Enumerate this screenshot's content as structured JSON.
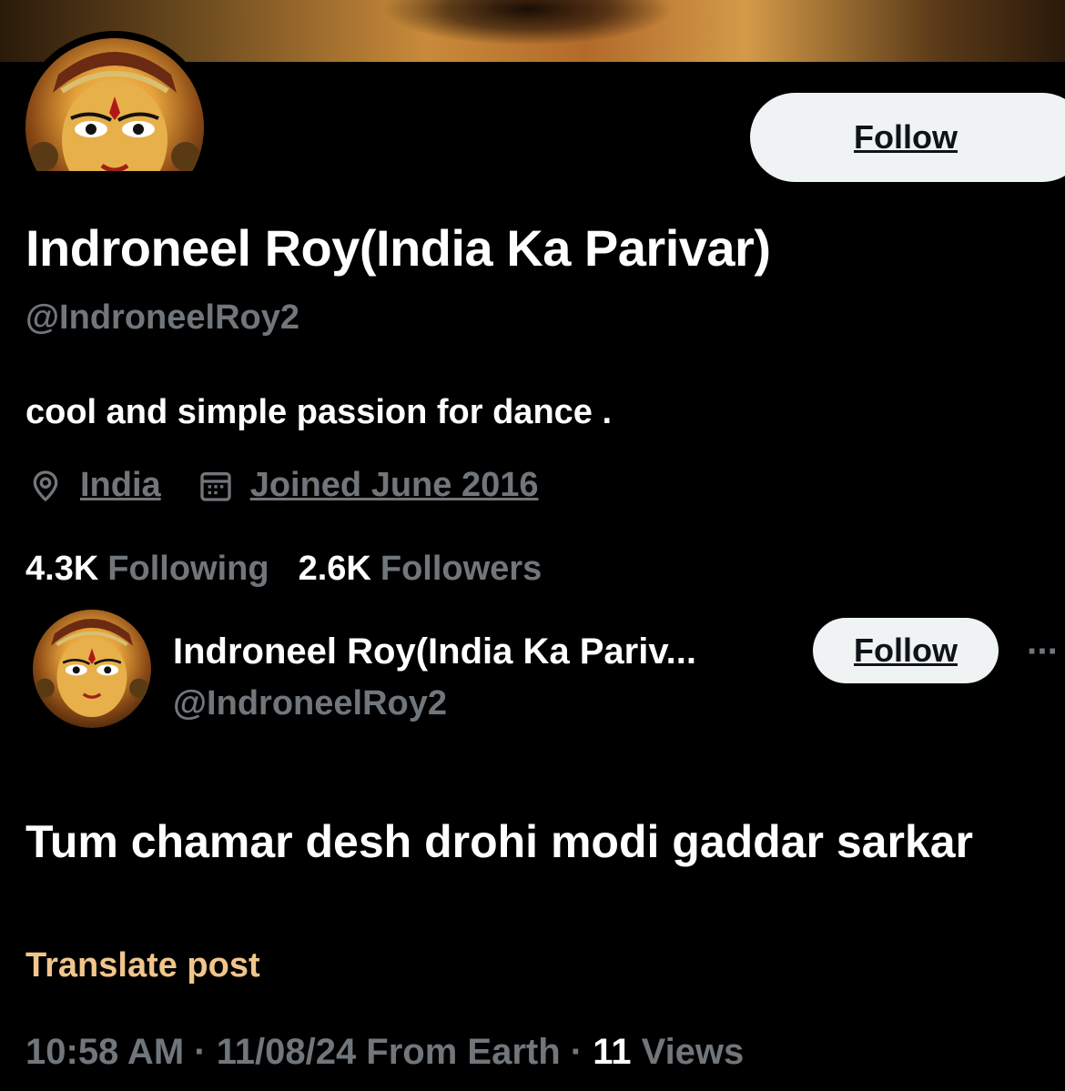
{
  "profile": {
    "display_name": "Indroneel Roy(India Ka Parivar)",
    "handle": "@IndroneelRoy2",
    "bio": "cool and simple passion for dance .",
    "location": "India",
    "joined": "Joined June 2016",
    "following_count": "4.3K",
    "following_label": "Following",
    "followers_count": "2.6K",
    "followers_label": "Followers",
    "follow_label": "Follow"
  },
  "post": {
    "author_name": "Indroneel Roy(India Ka Pariv...",
    "author_handle": "@IndroneelRoy2",
    "follow_label": "Follow",
    "more_label": "···",
    "text": "Tum chamar desh drohi modi gaddar sarkar",
    "translate_label": "Translate post",
    "time_date": "10:58 AM · 11/08/24 From Earth · ",
    "views_count": "11",
    "views_label": " Views"
  },
  "icons": {
    "location": "map-pin-icon",
    "joined": "calendar-icon",
    "more": "more-horizontal-icon"
  },
  "colors": {
    "background": "#000000",
    "primary_text": "#ffffff",
    "secondary_text": "#71767b",
    "follow_button": "#eff3f4",
    "translate_link": "#f1c58b"
  }
}
